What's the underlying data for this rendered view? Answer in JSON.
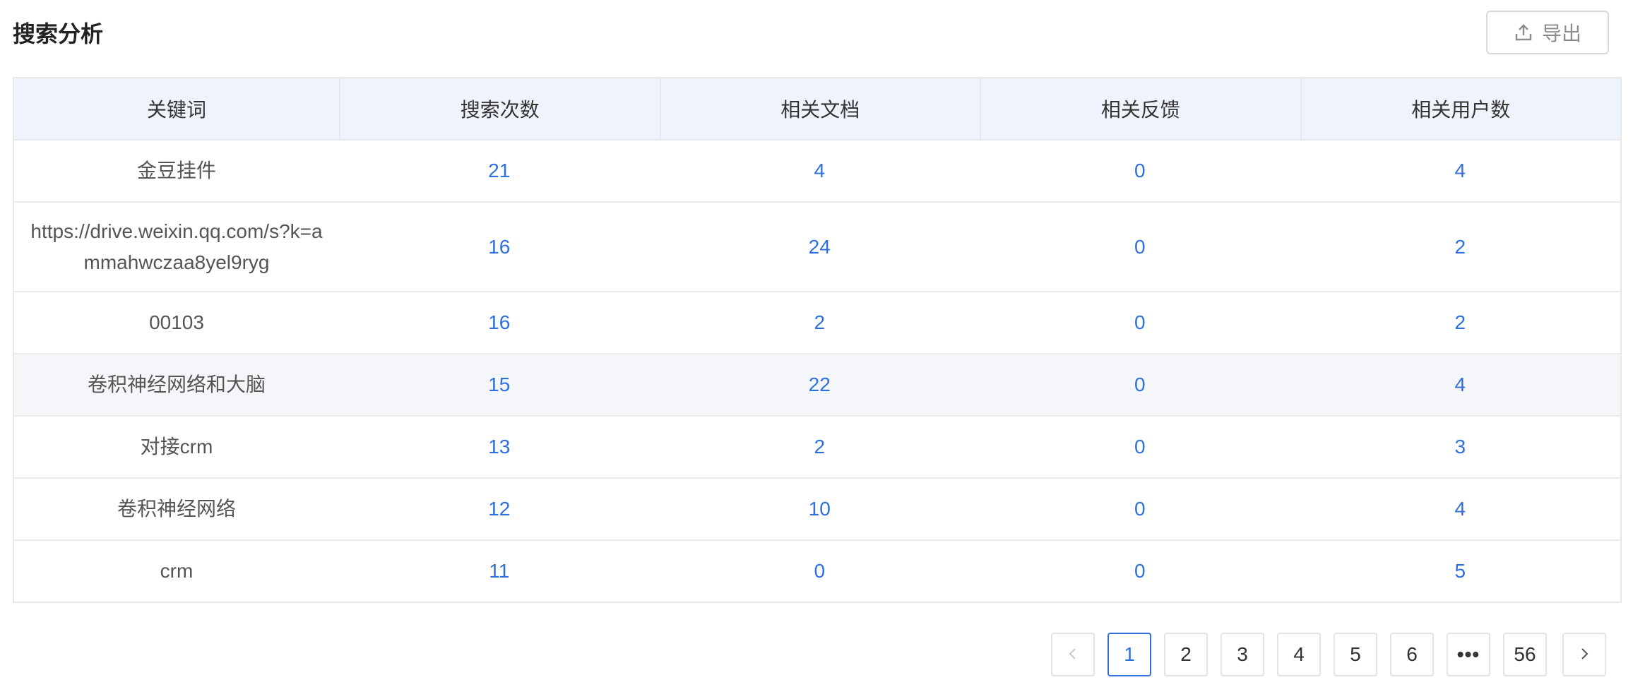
{
  "header": {
    "title": "搜索分析",
    "export_label": "导出"
  },
  "table": {
    "columns": [
      "关键词",
      "搜索次数",
      "相关文档",
      "相关反馈",
      "相关用户数"
    ],
    "rows": [
      {
        "keyword": "金豆挂件",
        "searches": "21",
        "docs": "4",
        "feedback": "0",
        "users": "4"
      },
      {
        "keyword": "https://drive.weixin.qq.com/s?k=ammahwczaa8yel9ryg",
        "searches": "16",
        "docs": "24",
        "feedback": "0",
        "users": "2"
      },
      {
        "keyword": "00103",
        "searches": "16",
        "docs": "2",
        "feedback": "0",
        "users": "2"
      },
      {
        "keyword": "卷积神经网络和大脑",
        "searches": "15",
        "docs": "22",
        "feedback": "0",
        "users": "4"
      },
      {
        "keyword": "对接crm",
        "searches": "13",
        "docs": "2",
        "feedback": "0",
        "users": "3"
      },
      {
        "keyword": "卷积神经网络",
        "searches": "12",
        "docs": "10",
        "feedback": "0",
        "users": "4"
      },
      {
        "keyword": "crm",
        "searches": "11",
        "docs": "0",
        "feedback": "0",
        "users": "5"
      }
    ]
  },
  "pagination": {
    "pages": [
      "1",
      "2",
      "3",
      "4",
      "5",
      "6",
      "•••",
      "56"
    ],
    "current": "1"
  },
  "colors": {
    "accent": "#2f6fde",
    "header_bg": "#eef3fc",
    "hover_row_bg": "#f4f6fa"
  }
}
